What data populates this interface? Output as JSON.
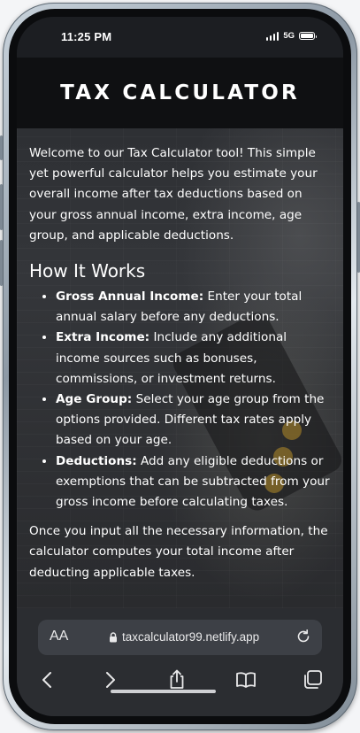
{
  "status_bar": {
    "time": "11:25 PM",
    "network": "5G"
  },
  "header": {
    "title": "TAX CALCULATOR"
  },
  "intro": "Welcome to our Tax Calculator tool! This simple yet powerful calculator helps you estimate your overall income after tax deductions based on your gross annual income, extra income, age group, and applicable deductions.",
  "how_it_works": {
    "heading": "How It Works",
    "items": [
      {
        "term": "Gross Annual Income:",
        "text": " Enter your total annual salary before any deductions."
      },
      {
        "term": "Extra Income:",
        "text": " Include any additional income sources such as bonuses, commissions, or investment returns."
      },
      {
        "term": "Age Group:",
        "text": " Select your age group from the options provided. Different tax rates apply based on your age."
      },
      {
        "term": "Deductions:",
        "text": " Add any eligible deductions or exemptions that can be subtracted from your gross income before calculating taxes."
      }
    ]
  },
  "outro": "Once you input all the necessary information, the calculator computes your total income after deducting applicable taxes.",
  "browser": {
    "text_size_label": "AA",
    "url": "taxcalculator99.netlify.app"
  },
  "icons": {
    "back": "chevron-left-icon",
    "forward": "chevron-right-icon",
    "share": "share-icon",
    "bookmarks": "book-icon",
    "tabs": "tabs-icon",
    "reload": "reload-icon",
    "lock": "lock-icon"
  }
}
